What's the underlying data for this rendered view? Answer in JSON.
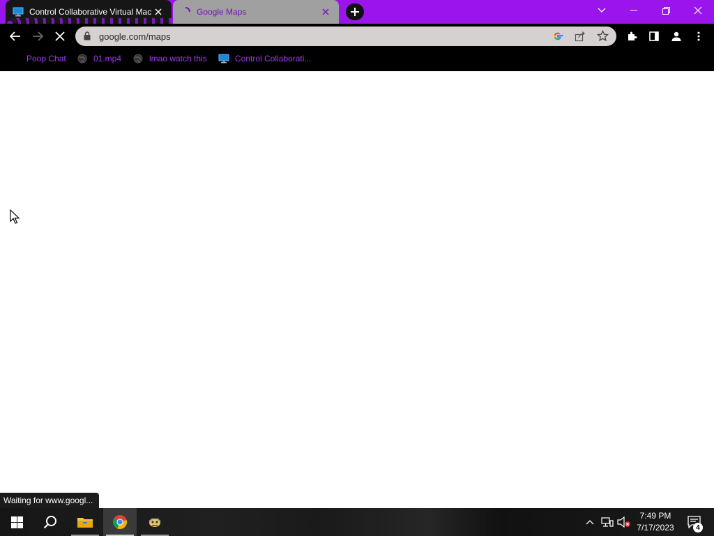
{
  "tabs": [
    {
      "title": "Control Collaborative Virtual Mac",
      "active": true
    },
    {
      "title": "Google Maps",
      "active": false
    }
  ],
  "address": {
    "url": "google.com/maps"
  },
  "bookmarks": [
    {
      "label": "Poop Chat",
      "icon": "none"
    },
    {
      "label": "01.mp4",
      "icon": "globe-icon"
    },
    {
      "label": "lmao watch this",
      "icon": "globe-icon"
    },
    {
      "label": "Control Collaborati...",
      "icon": "monitor-icon"
    }
  ],
  "status_text": "Waiting for www.googl...",
  "clock": {
    "time": "7:49 PM",
    "date": "7/17/2023"
  },
  "notification_count": "4",
  "colors": {
    "titlebar": "#9a14ec",
    "bookmark_text": "#9a3cf0",
    "toolbar": "#000000",
    "omnibox": "#d6d0d0"
  }
}
